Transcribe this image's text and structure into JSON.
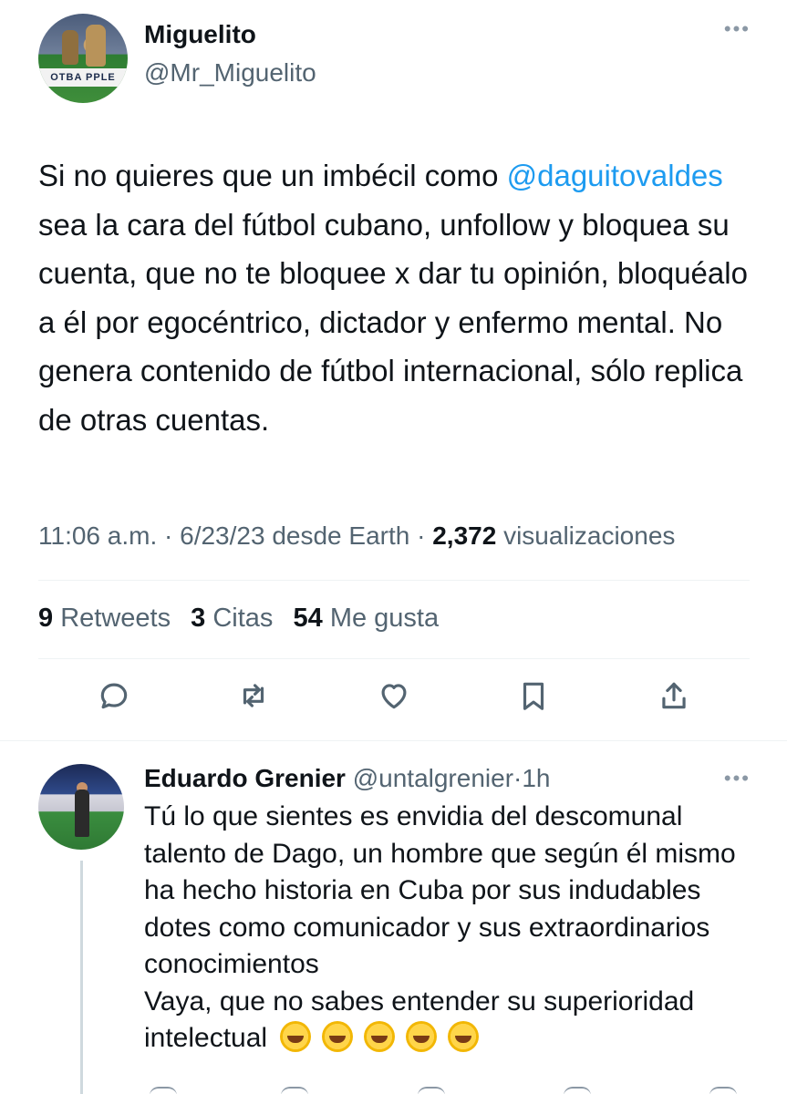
{
  "tweet": {
    "author_name": "Miguelito",
    "author_handle": "@Mr_Miguelito",
    "avatar_banner_text": "OTBA PPLE",
    "text_before_mention": "Si no quieres que un imbécil como ",
    "mention": "@daguitovaldes",
    "text_after_mention": " sea la cara del fútbol cubano, unfollow y bloquea su cuenta, que no te bloquee x dar tu opinión, bloquéalo a él por egocéntrico, dictador y enfermo mental. No genera contenido de fútbol internacional, sólo replica de otras cuentas.",
    "time": "11:06 a.m.",
    "date": "6/23/23",
    "source": "desde Earth",
    "views_count": "2,372",
    "views_label": "visualizaciones",
    "retweets_count": "9",
    "retweets_label": "Retweets",
    "quotes_count": "3",
    "quotes_label": "Citas",
    "likes_count": "54",
    "likes_label": "Me gusta",
    "more_label": "•••"
  },
  "actions": {
    "icons": [
      "reply-icon",
      "retweet-icon",
      "like-icon",
      "bookmark-icon",
      "share-icon"
    ]
  },
  "reply": {
    "author_name": "Eduardo Grenier",
    "author_handle": "@untalgrenier",
    "separator": "·",
    "time": "1h",
    "more_label": "•••",
    "text": "Tú lo que sientes es envidia del descomunal talento de Dago, un hombre que según él mismo ha hecho historia en Cuba por sus indudables dotes como comunicador y sus extraordinarios conocimientos\n Vaya, que no sabes entender su superioridad intelectual",
    "emoji_count": 5,
    "emoji_name": "rolling-on-floor-laughing-emoji"
  },
  "colors": {
    "text": "#0f1419",
    "secondary": "#536471",
    "link": "#1d9bf0",
    "divider": "#eff3f4"
  }
}
